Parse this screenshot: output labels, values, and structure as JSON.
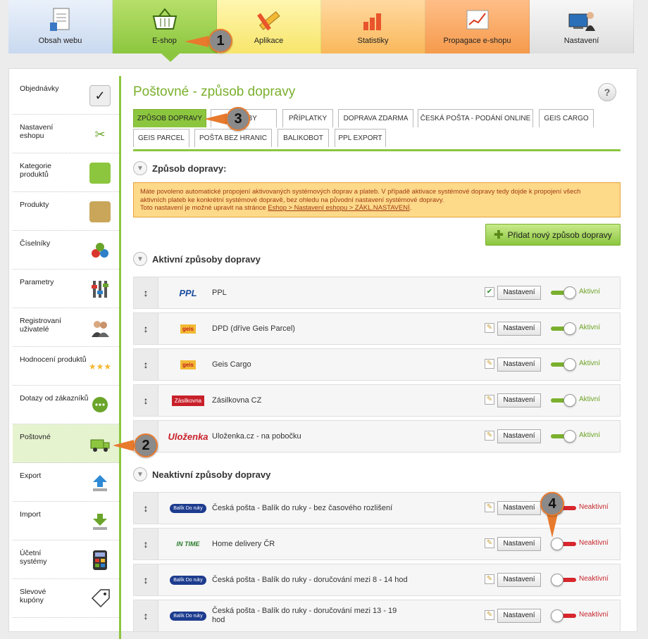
{
  "topnav": [
    {
      "label": "Obsah webu",
      "icon": "document-list-icon",
      "key": "obsah"
    },
    {
      "label": "E-shop",
      "icon": "basket-icon",
      "key": "eshop"
    },
    {
      "label": "Aplikace",
      "icon": "pencil-ruler-icon",
      "key": "aplikace"
    },
    {
      "label": "Statistiky",
      "icon": "bar-chart-icon",
      "key": "stat"
    },
    {
      "label": "Propagace e-shopu",
      "icon": "growth-chart-icon",
      "key": "prop"
    },
    {
      "label": "Nastavení",
      "icon": "user-computer-icon",
      "key": "nast"
    }
  ],
  "sidebar": [
    {
      "label": "Objednávky",
      "icon": "clipboard-icon"
    },
    {
      "label": "Nastavení\neshopu",
      "icon": "tools-icon"
    },
    {
      "label": "Kategorie\nproduktů",
      "icon": "folder-icon"
    },
    {
      "label": "Produkty",
      "icon": "boxes-icon"
    },
    {
      "label": "Číselníky",
      "icon": "numbers-icon"
    },
    {
      "label": "Parametry",
      "icon": "sliders-icon"
    },
    {
      "label": "Registrovaní\nuživatelé",
      "icon": "users-icon"
    },
    {
      "label": "Hodnocení produktů",
      "icon": "rating-stars-icon"
    },
    {
      "label": "Dotazy od zákazníků",
      "icon": "chat-bubble-icon"
    },
    {
      "label": "Poštovné",
      "icon": "truck-icon"
    },
    {
      "label": "Export",
      "icon": "upload-arrow-icon"
    },
    {
      "label": "Import",
      "icon": "download-arrow-icon"
    },
    {
      "label": "Účetní\nsystémy",
      "icon": "calculator-icon"
    },
    {
      "label": "Slevové\nkupóny",
      "icon": "coupon-tag-icon"
    }
  ],
  "page": {
    "title": "Poštovné - způsob dopravy",
    "help": "?",
    "tabs_row1": [
      "Způsob dopravy",
      "Platby",
      "Příplatky",
      "Doprava zdarma",
      "Česká pošta - podání online",
      "Geis cargo"
    ],
    "tabs_row2": [
      "Geis parcel",
      "Pošta bez hranic",
      "Balikobot",
      "PPL export"
    ],
    "section_main": "Způsob dopravy:",
    "notice_line1": "Máte povoleno automatické propojení aktivovaných systémových doprav a plateb. V případě aktivace systémové dopravy tedy dojde k propojení všech",
    "notice_line2": "aktivních plateb ke konkrétní systémové dopravě, bez ohledu na původní nastavení systémové dopravy.",
    "notice_line3": "Toto nastavení je možné upravit na stránce",
    "notice_link": "Eshop > Nastavení eshopu > ZÁKL.NASTAVENÍ",
    "notice_end": ".",
    "add_button": "Přidat nový způsob dopravy",
    "section_active": "Aktivní způsoby dopravy",
    "section_inactive": "Neaktivní způsoby dopravy",
    "settings_label": "Nastavení",
    "active_label": "Aktivní",
    "inactive_label": "Neaktivní"
  },
  "active_rows": [
    {
      "name": "PPL",
      "logo": "PPL",
      "checked": true
    },
    {
      "name": "DPD (dříve Geis Parcel)",
      "logo": "geis",
      "checked": false
    },
    {
      "name": "Geis Cargo",
      "logo": "geis",
      "checked": false
    },
    {
      "name": "Zásilkovna CZ",
      "logo": "Zásilkovna",
      "checked": false
    },
    {
      "name": "Uloženka.cz - na pobočku",
      "logo": "Uloženka",
      "checked": false
    }
  ],
  "inactive_rows": [
    {
      "name": "Česká pošta - Balík do ruky - bez časového rozlišení",
      "logo": "Balík Do ruky"
    },
    {
      "name": "Home delivery ČR",
      "logo": "IN TIME"
    },
    {
      "name": "Česká pošta - Balík do ruky - doručování mezi 8 - 14 hod",
      "logo": "Balík Do ruky"
    },
    {
      "name": "Česká pošta - Balík do ruky - doručování mezi 13 - 19 hod",
      "logo": "Balík Do ruky"
    }
  ],
  "callouts": [
    "1",
    "2",
    "3",
    "4"
  ]
}
